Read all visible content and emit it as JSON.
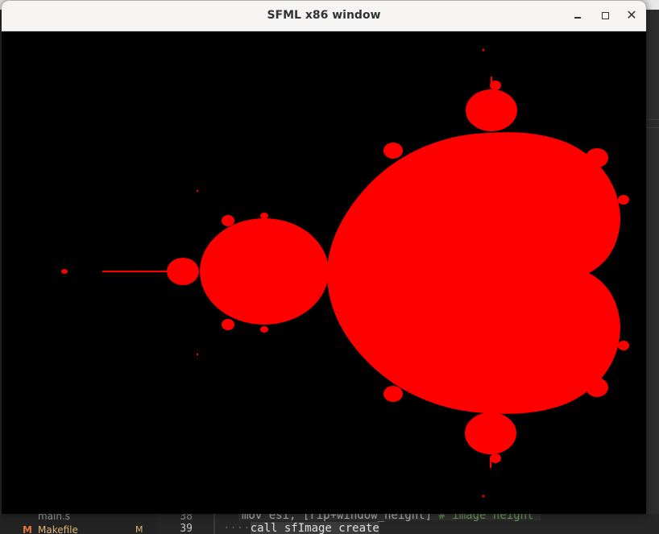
{
  "window": {
    "title": "SFML x86 window",
    "content": "mandelbrot-set",
    "colors": {
      "set": "#ff0000",
      "background": "#000000",
      "titlebar": "#f6f5f4"
    }
  },
  "editor": {
    "explorer": [
      {
        "icon": "",
        "name": "main.s",
        "badge": ""
      },
      {
        "icon": "M",
        "name": "Makefile",
        "badge": "M"
      }
    ],
    "line_numbers": [
      "38",
      "39"
    ],
    "code_lines": [
      {
        "code": "mov esi, [rip+window_height]",
        "comment": "# image height"
      },
      {
        "indent": "····",
        "code": "call sfImage_create"
      }
    ]
  }
}
